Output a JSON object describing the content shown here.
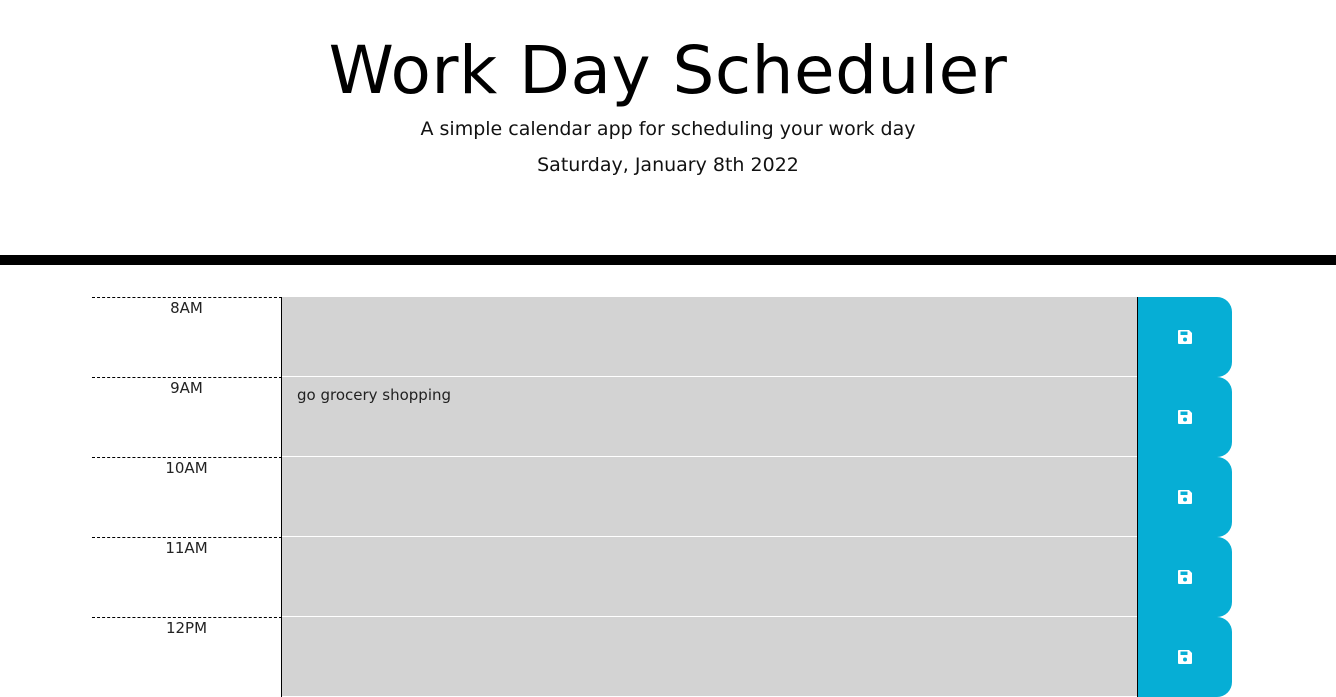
{
  "header": {
    "title": "Work Day Scheduler",
    "subtitle": "A simple calendar app for scheduling your work day",
    "current_day": "Saturday, January 8th 2022"
  },
  "time_blocks": [
    {
      "hour": "8AM",
      "description": ""
    },
    {
      "hour": "9AM",
      "description": "go grocery shopping"
    },
    {
      "hour": "10AM",
      "description": ""
    },
    {
      "hour": "11AM",
      "description": ""
    },
    {
      "hour": "12PM",
      "description": ""
    }
  ],
  "icons": {
    "save": "floppy-disk-icon"
  },
  "colors": {
    "save_button": "#06aed5",
    "description_bg": "#d3d3d3",
    "header_border": "#000000"
  }
}
